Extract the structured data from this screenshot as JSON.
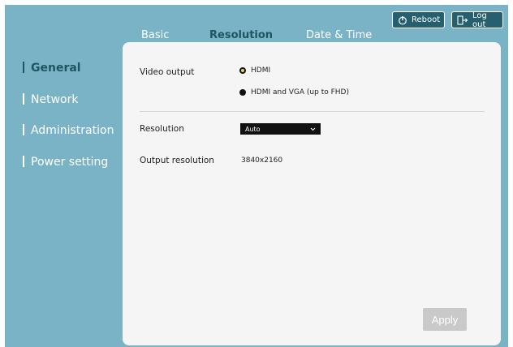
{
  "header": {
    "reboot_label": "Reboot",
    "logout_label": "Log out"
  },
  "tabs": [
    {
      "label": "Basic",
      "active": false
    },
    {
      "label": "Resolution",
      "active": true
    },
    {
      "label": "Date & Time",
      "active": false
    }
  ],
  "sidebar": {
    "items": [
      {
        "label": "General",
        "active": true
      },
      {
        "label": "Network",
        "active": false
      },
      {
        "label": "Administration",
        "active": false
      },
      {
        "label": "Power setting",
        "active": false
      }
    ]
  },
  "form": {
    "video_output_label": "Video output",
    "video_output_options": [
      {
        "label": "HDMI",
        "selected": true
      },
      {
        "label": "HDMI and VGA (up to FHD)",
        "selected": false
      }
    ],
    "resolution_label": "Resolution",
    "resolution_value": "Auto",
    "output_resolution_label": "Output resolution",
    "output_resolution_value": "3840x2160",
    "apply_label": "Apply"
  },
  "colors": {
    "background": "#7ab3c6",
    "button_dark": "#26606f",
    "active_text": "#1f5561",
    "panel": "#f5f5f5",
    "apply_disabled": "#c9c9c9"
  }
}
